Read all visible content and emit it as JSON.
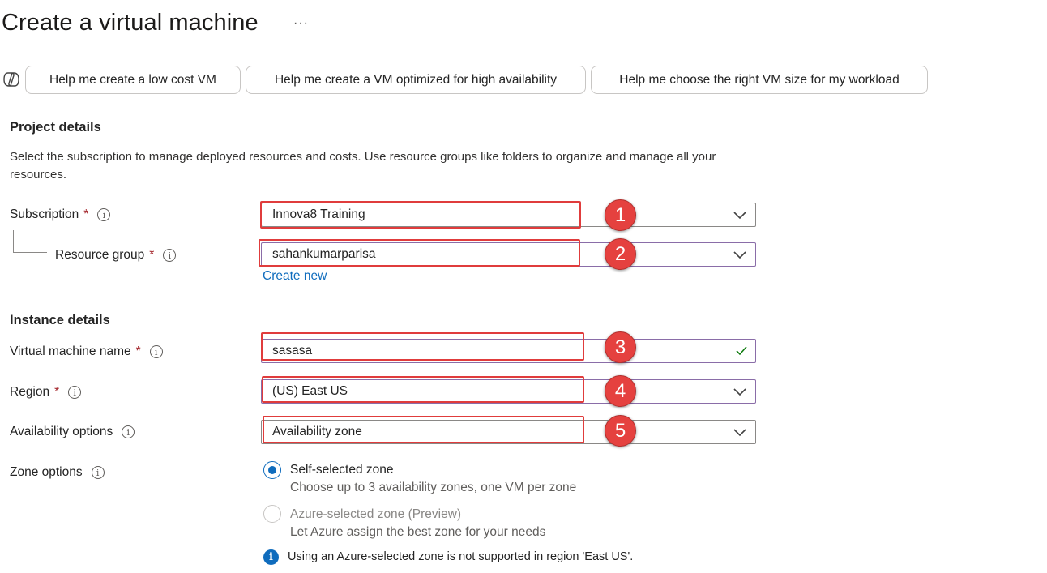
{
  "header": {
    "title": "Create a virtual machine",
    "more_icon": "ellipsis-icon"
  },
  "copilot": {
    "icon": "copilot-icon",
    "prompts": [
      "Help me create a low cost VM",
      "Help me create a VM optimized for high availability",
      "Help me choose the right VM size for my workload"
    ]
  },
  "project": {
    "heading": "Project details",
    "description": "Select the subscription to manage deployed resources and costs. Use resource groups like folders to organize and manage all your resources.",
    "subscription": {
      "label": "Subscription",
      "required": "*",
      "value": "Innova8 Training"
    },
    "resource_group": {
      "label": "Resource group",
      "required": "*",
      "value": "sahankumarparisa",
      "create_link": "Create new"
    }
  },
  "instance": {
    "heading": "Instance details",
    "vm_name": {
      "label": "Virtual machine name",
      "required": "*",
      "value": "sasasa",
      "valid_icon": "checkmark-icon"
    },
    "region": {
      "label": "Region",
      "required": "*",
      "value": "(US) East US"
    },
    "availability": {
      "label": "Availability options",
      "value": "Availability zone"
    },
    "zone_options": {
      "label": "Zone options",
      "options": [
        {
          "title": "Self-selected zone",
          "description": "Choose up to 3 availability zones, one VM per zone",
          "checked": true,
          "disabled": false
        },
        {
          "title": "Azure-selected zone (Preview)",
          "description": "Let Azure assign the best zone for your needs",
          "checked": false,
          "disabled": true
        }
      ],
      "note": "Using an Azure-selected zone is not supported in region 'East US'."
    }
  },
  "annotations": [
    "1",
    "2",
    "3",
    "4",
    "5"
  ],
  "colors": {
    "highlight": "#e03c3c",
    "badge": "#e5413f",
    "link": "#0f6cbd",
    "required": "#a4262c",
    "valid": "#107c10"
  }
}
